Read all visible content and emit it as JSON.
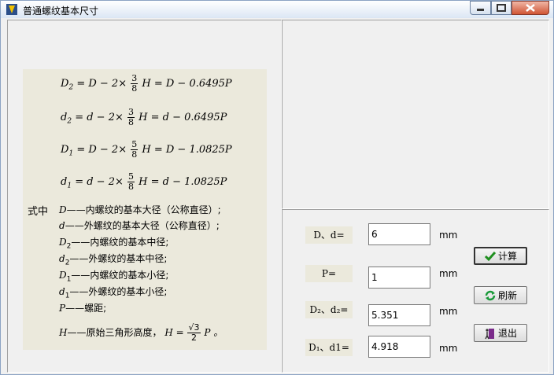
{
  "window": {
    "title": "普通螺纹基本尺寸"
  },
  "formulas": {
    "f1": {
      "lhs": "D",
      "lhs_sub": "2",
      "left": "= D − 2×",
      "num": "3",
      "den": "8",
      "right": "H = D − 0.6495P"
    },
    "f2": {
      "lhs": "d",
      "lhs_sub": "2",
      "left": "= d − 2×",
      "num": "3",
      "den": "8",
      "right": "H = d − 0.6495P"
    },
    "f3": {
      "lhs": "D",
      "lhs_sub": "1",
      "left": "= D − 2×",
      "num": "5",
      "den": "8",
      "right": "H = D − 1.0825P"
    },
    "f4": {
      "lhs": "d",
      "lhs_sub": "1",
      "left": "= d − 2×",
      "num": "5",
      "den": "8",
      "right": "H = d − 1.0825P"
    }
  },
  "legend": {
    "heading": "式中",
    "items": [
      {
        "sym": "D",
        "sub": "",
        "text": "——内螺纹的基本大径（公称直径）;"
      },
      {
        "sym": "d",
        "sub": "",
        "text": "——外螺纹的基本大径（公称直径）;"
      },
      {
        "sym": "D",
        "sub": "2",
        "text": "——内螺纹的基本中径;"
      },
      {
        "sym": "d",
        "sub": "2",
        "text": "——外螺纹的基本中径;"
      },
      {
        "sym": "D",
        "sub": "1",
        "text": "——内螺纹的基本小径;"
      },
      {
        "sym": "d",
        "sub": "1",
        "text": "——外螺纹的基本小径;"
      },
      {
        "sym": "P",
        "sub": "",
        "text": "——螺距;"
      }
    ],
    "h_line": {
      "sym": "H",
      "text": "——原始三角形高度，",
      "expr_lhs": "H =",
      "num": "√3",
      "den": "2",
      "expr_rhs": "P 。"
    }
  },
  "fields": [
    {
      "label": "D、d=",
      "value": "6",
      "unit": "mm"
    },
    {
      "label": "P=",
      "value": "1",
      "unit": "mm"
    },
    {
      "label": "D₂、d₂=",
      "value": "5.351",
      "unit": "mm"
    },
    {
      "label": "D₁、d1=",
      "value": "4.918",
      "unit": "mm"
    }
  ],
  "buttons": {
    "calc": "计算",
    "refresh": "刷新",
    "exit": "退出"
  },
  "colors": {
    "formula_bg": "#ebe9dc",
    "check_green": "#1f8f1f",
    "refresh_green": "#1a9a3a",
    "exit_purple": "#7a2a8a"
  }
}
